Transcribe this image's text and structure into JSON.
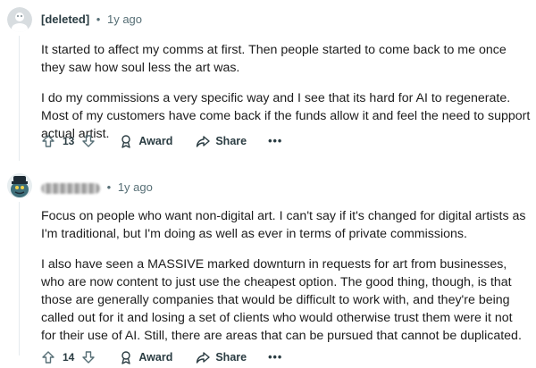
{
  "comments": [
    {
      "author": "[deleted]",
      "separator": "•",
      "time": "1y ago",
      "paragraphs": [
        "It started to affect my comms at first. Then people started to come back to me once they saw how soul less the art was.",
        "I do my commissions a very specific way and I see that its hard for AI to regenerate. Most of my customers have come back if the funds allow it and feel the need to support actual artist."
      ],
      "score": "13",
      "award_label": "Award",
      "share_label": "Share",
      "more_label": "•••"
    },
    {
      "author": "",
      "separator": "•",
      "time": "1y ago",
      "paragraphs": [
        "Focus on people who want non-digital art. I can't say if it's changed for digital artists as I'm traditional, but I'm doing as well as ever in terms of private commissions.",
        "I also have seen a MASSIVE marked downturn in requests for art from businesses, who are now content to just use the cheapest option. The good thing, though, is that those are generally companies that would be difficult to work with, and they're being called out for it and losing a set of clients who would otherwise trust them were it not for their use of AI. Still, there are areas that can be pursued that cannot be duplicated."
      ],
      "score": "14",
      "award_label": "Award",
      "share_label": "Share",
      "more_label": "•••"
    }
  ],
  "colors": {
    "meta": "#576f76",
    "text": "#1c1c1c",
    "thread_line": "#e5ebee"
  },
  "icons": {
    "upvote": "upvote-arrow-icon",
    "downvote": "downvote-arrow-icon",
    "award": "award-ribbon-icon",
    "share": "share-arrow-icon",
    "avatar1": "deleted-user-avatar",
    "avatar2": "user-avatar"
  }
}
